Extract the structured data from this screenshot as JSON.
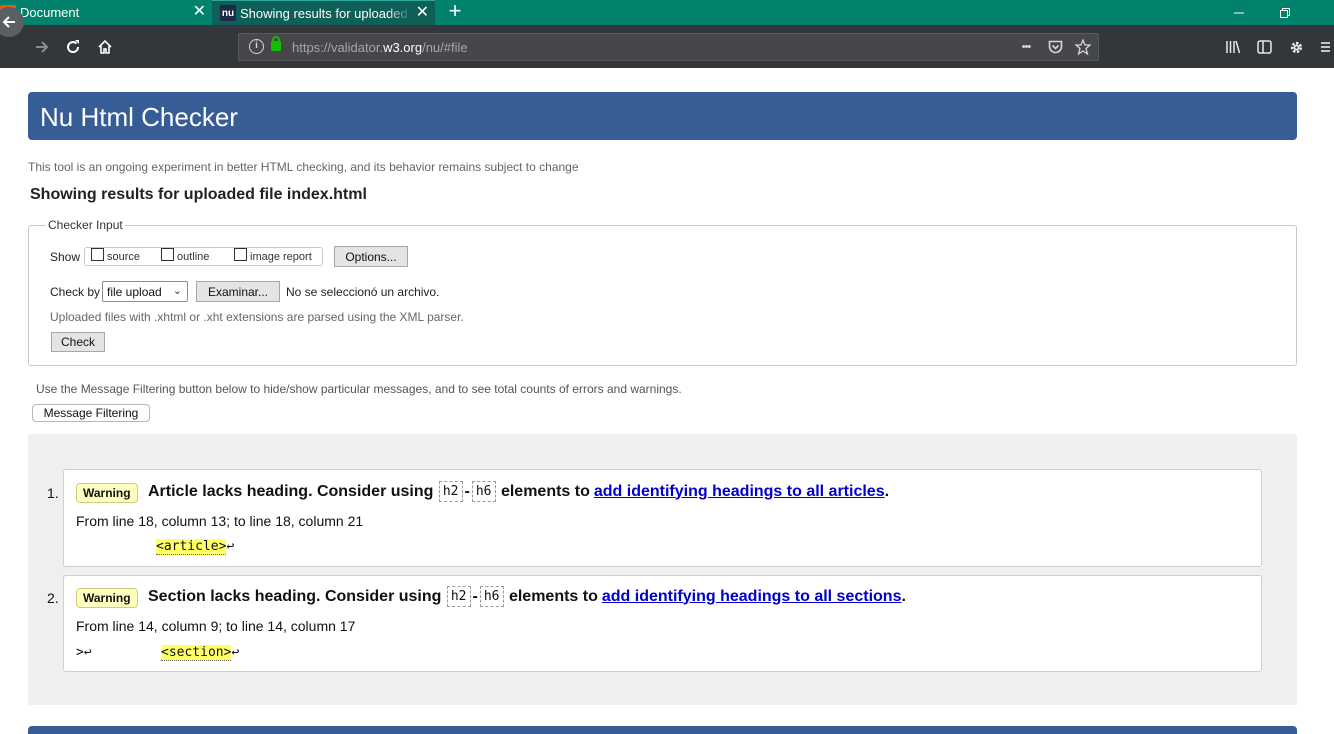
{
  "browser": {
    "tabs": [
      {
        "title": "Document",
        "icon": "xampp-icon"
      },
      {
        "title": "Showing results for uploaded file index.html",
        "icon": "nu-icon",
        "icon_text": "nu"
      }
    ],
    "url_prefix": "https://validator.",
    "url_domain": "w3.org",
    "url_path": "/nu/#file",
    "ellipsis": "•••"
  },
  "page": {
    "title": "Nu Html Checker",
    "tagline": "This tool is an ongoing experiment in better HTML checking, and its behavior remains subject to change",
    "results_heading": "Showing results for uploaded file index.html"
  },
  "checker_input": {
    "legend": "Checker Input",
    "show_label": "Show",
    "options": [
      "source",
      "outline",
      "image report"
    ],
    "options_button": "Options...",
    "check_by_label": "Check by",
    "check_by_value": "file upload",
    "browse_button": "Examinar...",
    "no_file_text": "No se seleccionó un archivo.",
    "hint": "Uploaded files with .xhtml or .xht extensions are parsed using the XML parser.",
    "check_button": "Check"
  },
  "filtering": {
    "text": "Use the Message Filtering button below to hide/show particular messages, and to see total counts of errors and warnings.",
    "button": "Message Filtering"
  },
  "messages": [
    {
      "number": "1.",
      "type": "Warning",
      "text_before": "Article lacks heading. Consider using",
      "code_a": "h2",
      "dash": "-",
      "code_b": "h6",
      "text_after": "elements to",
      "link": "add identifying headings to all articles",
      "end": ".",
      "location": "From line 18, column 13; to line 18, column 21",
      "extract_pre": "",
      "extract_tag": "<article>",
      "extract_post": "↩"
    },
    {
      "number": "2.",
      "type": "Warning",
      "text_before": "Section lacks heading. Consider using",
      "code_a": "h2",
      "dash": "-",
      "code_b": "h6",
      "text_after": "elements to",
      "link": "add identifying headings to all sections",
      "end": ".",
      "location": "From line 14, column 9; to line 14, column 17",
      "extract_pre": ">↩",
      "extract_tag": "<section>",
      "extract_post": "↩"
    }
  ],
  "colors": {
    "tab_bar": "#00826d",
    "toolbar": "#32373c",
    "header": "#365d95",
    "warning_badge": "#ffffc0",
    "highlight": "#ffff66",
    "link": "#0000cc"
  }
}
